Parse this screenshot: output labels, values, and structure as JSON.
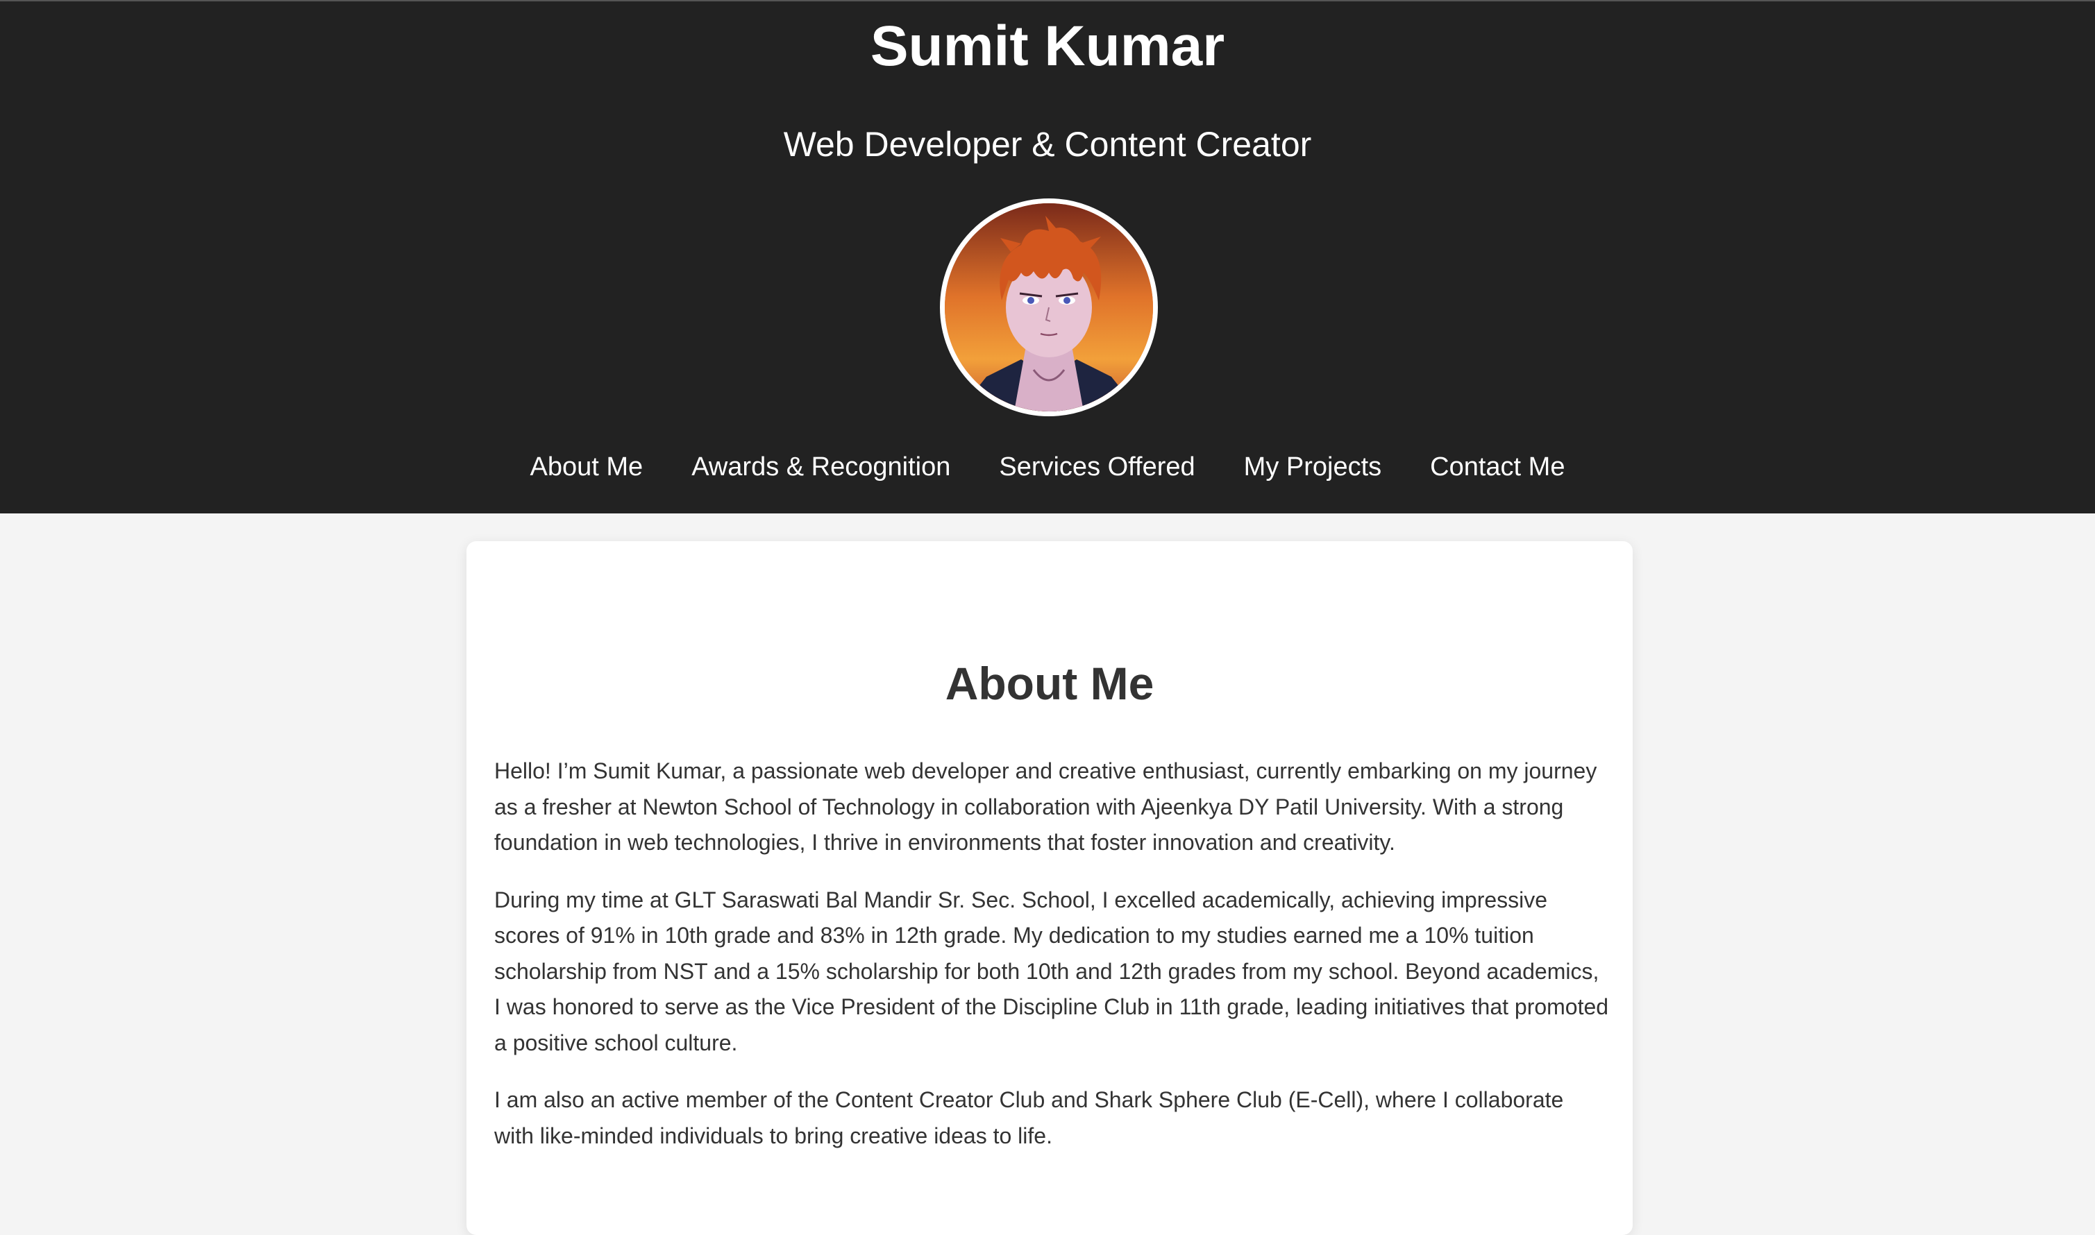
{
  "header": {
    "title": "Sumit Kumar",
    "subtitle": "Web Developer & Content Creator",
    "avatar_icon": "anime-portrait-avatar"
  },
  "nav": {
    "items": [
      {
        "label": "About Me"
      },
      {
        "label": "Awards & Recognition"
      },
      {
        "label": "Services Offered"
      },
      {
        "label": "My Projects"
      },
      {
        "label": "Contact Me"
      }
    ]
  },
  "about": {
    "heading": "About Me",
    "paragraphs": [
      "Hello! I’m Sumit Kumar, a passionate web developer and creative enthusiast, currently embarking on my journey as a fresher at Newton School of Technology in collaboration with Ajeenkya DY Patil University. With a strong foundation in web technologies, I thrive in environments that foster innovation and creativity.",
      "During my time at GLT Saraswati Bal Mandir Sr. Sec. School, I excelled academically, achieving impressive scores of 91% in 10th grade and 83% in 12th grade. My dedication to my studies earned me a 10% tuition scholarship from NST and a 15% scholarship for both 10th and 12th grades from my school. Beyond academics, I was honored to serve as the Vice President of the Discipline Club in 11th grade, leading initiatives that promoted a positive school culture.",
      "I am also an active member of the Content Creator Club and Shark Sphere Club (E-Cell), where I collaborate with like-minded individuals to bring creative ideas to life."
    ]
  },
  "colors": {
    "header_bg": "#222222",
    "page_bg": "#f4f4f4",
    "card_bg": "#ffffff",
    "text": "#333333"
  }
}
